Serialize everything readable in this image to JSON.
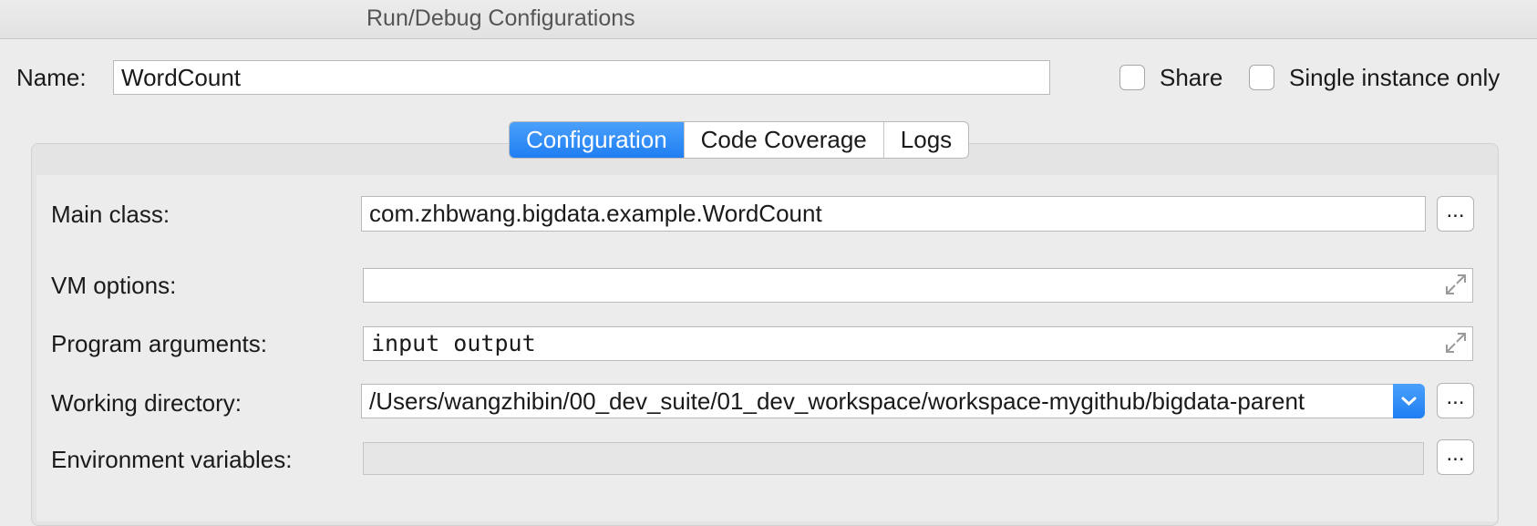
{
  "window": {
    "title": "Run/Debug Configurations"
  },
  "header": {
    "name_label": "Name:",
    "name_value": "WordCount",
    "share_label": "Share",
    "single_instance_label": "Single instance only"
  },
  "tabs": [
    {
      "label": "Configuration",
      "active": true
    },
    {
      "label": "Code Coverage",
      "active": false
    },
    {
      "label": "Logs",
      "active": false
    }
  ],
  "form": {
    "main_class_label": "Main class:",
    "main_class_value": "com.zhbwang.bigdata.example.WordCount",
    "vm_options_label": "VM options:",
    "vm_options_value": "",
    "program_args_label": "Program arguments:",
    "program_args_value": "input output",
    "working_dir_label": "Working directory:",
    "working_dir_value": "/Users/wangzhibin/00_dev_suite/01_dev_workspace/workspace-mygithub/bigdata-parent",
    "env_vars_label": "Environment variables:",
    "env_vars_value": "",
    "browse_label": "..."
  },
  "colors": {
    "accent": "#1f7ef2",
    "window_bg": "#ececec"
  }
}
